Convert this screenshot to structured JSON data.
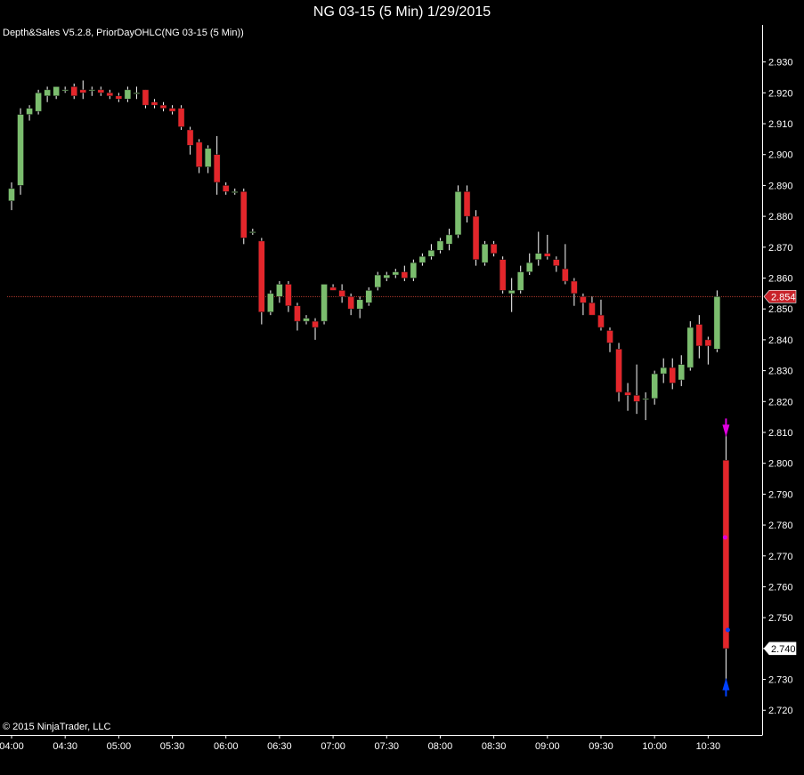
{
  "title": "NG 03-15 (5 Min)  1/29/2015",
  "indicator_label": "Depth&Sales V5.2.8, PriorDayOHLC(NG 03-15 (5 Min))",
  "copyright": "© 2015 NinjaTrader, LLC",
  "colors": {
    "background": "#000000",
    "up": "#7bbd6e",
    "down": "#e3262b",
    "prior_close_line": "#b13a2e",
    "markers_top": "#e000e0",
    "markers_bottom": "#0040ff"
  },
  "chart_data": {
    "type": "candlestick",
    "title": "NG 03-15 (5 Min)  1/29/2015",
    "ylim": [
      2.712,
      2.942
    ],
    "y_ticks": [
      "2.930",
      "2.920",
      "2.910",
      "2.900",
      "2.890",
      "2.880",
      "2.870",
      "2.860",
      "2.850",
      "2.840",
      "2.830",
      "2.820",
      "2.810",
      "2.800",
      "2.790",
      "2.780",
      "2.770",
      "2.760",
      "2.750",
      "2.740",
      "2.730",
      "2.720"
    ],
    "x_ticks": [
      "04:00",
      "04:30",
      "05:00",
      "05:30",
      "06:00",
      "06:30",
      "07:00",
      "07:30",
      "08:00",
      "08:30",
      "09:00",
      "09:30",
      "10:00",
      "10:30"
    ],
    "prior_day_close": {
      "value": 2.854,
      "label": "2.854"
    },
    "last_price": {
      "value": 2.74,
      "label": "2.740"
    },
    "candles": [
      {
        "o": 2.885,
        "h": 2.891,
        "l": 2.882,
        "c": 2.889
      },
      {
        "o": 2.89,
        "h": 2.915,
        "l": 2.887,
        "c": 2.913
      },
      {
        "o": 2.913,
        "h": 2.916,
        "l": 2.911,
        "c": 2.915
      },
      {
        "o": 2.914,
        "h": 2.921,
        "l": 2.913,
        "c": 2.92
      },
      {
        "o": 2.919,
        "h": 2.922,
        "l": 2.917,
        "c": 2.921
      },
      {
        "o": 2.919,
        "h": 2.922,
        "l": 2.918,
        "c": 2.922
      },
      {
        "o": 2.921,
        "h": 2.922,
        "l": 2.92,
        "c": 2.921
      },
      {
        "o": 2.922,
        "h": 2.923,
        "l": 2.918,
        "c": 2.919
      },
      {
        "o": 2.921,
        "h": 2.924,
        "l": 2.918,
        "c": 2.92
      },
      {
        "o": 2.921,
        "h": 2.922,
        "l": 2.919,
        "c": 2.921
      },
      {
        "o": 2.921,
        "h": 2.922,
        "l": 2.919,
        "c": 2.92
      },
      {
        "o": 2.92,
        "h": 2.921,
        "l": 2.918,
        "c": 2.919
      },
      {
        "o": 2.919,
        "h": 2.92,
        "l": 2.917,
        "c": 2.918
      },
      {
        "o": 2.918,
        "h": 2.922,
        "l": 2.917,
        "c": 2.921
      },
      {
        "o": 2.92,
        "h": 2.922,
        "l": 2.918,
        "c": 2.92
      },
      {
        "o": 2.921,
        "h": 2.921,
        "l": 2.915,
        "c": 2.916
      },
      {
        "o": 2.917,
        "h": 2.918,
        "l": 2.915,
        "c": 2.916
      },
      {
        "o": 2.916,
        "h": 2.917,
        "l": 2.914,
        "c": 2.915
      },
      {
        "o": 2.915,
        "h": 2.916,
        "l": 2.913,
        "c": 2.914
      },
      {
        "o": 2.915,
        "h": 2.916,
        "l": 2.908,
        "c": 2.909
      },
      {
        "o": 2.908,
        "h": 2.909,
        "l": 2.9,
        "c": 2.903
      },
      {
        "o": 2.904,
        "h": 2.905,
        "l": 2.894,
        "c": 2.896
      },
      {
        "o": 2.896,
        "h": 2.903,
        "l": 2.894,
        "c": 2.902
      },
      {
        "o": 2.9,
        "h": 2.906,
        "l": 2.887,
        "c": 2.891
      },
      {
        "o": 2.89,
        "h": 2.891,
        "l": 2.887,
        "c": 2.888
      },
      {
        "o": 2.888,
        "h": 2.889,
        "l": 2.887,
        "c": 2.888
      },
      {
        "o": 2.888,
        "h": 2.889,
        "l": 2.871,
        "c": 2.873
      },
      {
        "o": 2.875,
        "h": 2.876,
        "l": 2.874,
        "c": 2.875
      },
      {
        "o": 2.872,
        "h": 2.873,
        "l": 2.845,
        "c": 2.849
      },
      {
        "o": 2.849,
        "h": 2.856,
        "l": 2.848,
        "c": 2.855
      },
      {
        "o": 2.854,
        "h": 2.859,
        "l": 2.852,
        "c": 2.858
      },
      {
        "o": 2.858,
        "h": 2.859,
        "l": 2.849,
        "c": 2.851
      },
      {
        "o": 2.851,
        "h": 2.852,
        "l": 2.843,
        "c": 2.846
      },
      {
        "o": 2.846,
        "h": 2.848,
        "l": 2.845,
        "c": 2.847
      },
      {
        "o": 2.846,
        "h": 2.847,
        "l": 2.84,
        "c": 2.844
      },
      {
        "o": 2.846,
        "h": 2.858,
        "l": 2.845,
        "c": 2.858
      },
      {
        "o": 2.857,
        "h": 2.858,
        "l": 2.856,
        "c": 2.856
      },
      {
        "o": 2.856,
        "h": 2.858,
        "l": 2.852,
        "c": 2.854
      },
      {
        "o": 2.854,
        "h": 2.855,
        "l": 2.848,
        "c": 2.85
      },
      {
        "o": 2.85,
        "h": 2.854,
        "l": 2.847,
        "c": 2.853
      },
      {
        "o": 2.852,
        "h": 2.857,
        "l": 2.851,
        "c": 2.856
      },
      {
        "o": 2.857,
        "h": 2.862,
        "l": 2.856,
        "c": 2.861
      },
      {
        "o": 2.86,
        "h": 2.862,
        "l": 2.859,
        "c": 2.861
      },
      {
        "o": 2.861,
        "h": 2.863,
        "l": 2.86,
        "c": 2.862
      },
      {
        "o": 2.862,
        "h": 2.864,
        "l": 2.859,
        "c": 2.86
      },
      {
        "o": 2.86,
        "h": 2.866,
        "l": 2.859,
        "c": 2.865
      },
      {
        "o": 2.865,
        "h": 2.868,
        "l": 2.864,
        "c": 2.867
      },
      {
        "o": 2.867,
        "h": 2.871,
        "l": 2.866,
        "c": 2.869
      },
      {
        "o": 2.869,
        "h": 2.873,
        "l": 2.868,
        "c": 2.872
      },
      {
        "o": 2.871,
        "h": 2.876,
        "l": 2.869,
        "c": 2.874
      },
      {
        "o": 2.874,
        "h": 2.89,
        "l": 2.873,
        "c": 2.888
      },
      {
        "o": 2.888,
        "h": 2.89,
        "l": 2.878,
        "c": 2.88
      },
      {
        "o": 2.88,
        "h": 2.882,
        "l": 2.864,
        "c": 2.866
      },
      {
        "o": 2.865,
        "h": 2.872,
        "l": 2.864,
        "c": 2.871
      },
      {
        "o": 2.871,
        "h": 2.872,
        "l": 2.867,
        "c": 2.868
      },
      {
        "o": 2.866,
        "h": 2.867,
        "l": 2.855,
        "c": 2.856
      },
      {
        "o": 2.855,
        "h": 2.86,
        "l": 2.849,
        "c": 2.856
      },
      {
        "o": 2.856,
        "h": 2.864,
        "l": 2.855,
        "c": 2.862
      },
      {
        "o": 2.862,
        "h": 2.868,
        "l": 2.861,
        "c": 2.865
      },
      {
        "o": 2.866,
        "h": 2.875,
        "l": 2.864,
        "c": 2.868
      },
      {
        "o": 2.868,
        "h": 2.874,
        "l": 2.866,
        "c": 2.867
      },
      {
        "o": 2.866,
        "h": 2.867,
        "l": 2.862,
        "c": 2.864
      },
      {
        "o": 2.863,
        "h": 2.871,
        "l": 2.858,
        "c": 2.859
      },
      {
        "o": 2.859,
        "h": 2.86,
        "l": 2.851,
        "c": 2.855
      },
      {
        "o": 2.854,
        "h": 2.855,
        "l": 2.848,
        "c": 2.852
      },
      {
        "o": 2.852,
        "h": 2.854,
        "l": 2.848,
        "c": 2.848
      },
      {
        "o": 2.848,
        "h": 2.853,
        "l": 2.843,
        "c": 2.844
      },
      {
        "o": 2.843,
        "h": 2.844,
        "l": 2.836,
        "c": 2.839
      },
      {
        "o": 2.837,
        "h": 2.839,
        "l": 2.82,
        "c": 2.823
      },
      {
        "o": 2.823,
        "h": 2.826,
        "l": 2.817,
        "c": 2.822
      },
      {
        "o": 2.822,
        "h": 2.832,
        "l": 2.816,
        "c": 2.82
      },
      {
        "o": 2.821,
        "h": 2.823,
        "l": 2.814,
        "c": 2.821
      },
      {
        "o": 2.821,
        "h": 2.83,
        "l": 2.819,
        "c": 2.829
      },
      {
        "o": 2.829,
        "h": 2.834,
        "l": 2.826,
        "c": 2.831
      },
      {
        "o": 2.831,
        "h": 2.834,
        "l": 2.824,
        "c": 2.826
      },
      {
        "o": 2.827,
        "h": 2.835,
        "l": 2.825,
        "c": 2.832
      },
      {
        "o": 2.831,
        "h": 2.846,
        "l": 2.83,
        "c": 2.844
      },
      {
        "o": 2.845,
        "h": 2.848,
        "l": 2.834,
        "c": 2.838
      },
      {
        "o": 2.84,
        "h": 2.841,
        "l": 2.832,
        "c": 2.838
      },
      {
        "o": 2.837,
        "h": 2.856,
        "l": 2.836,
        "c": 2.854
      },
      {
        "o": 2.801,
        "h": 2.81,
        "l": 2.729,
        "c": 2.74
      }
    ]
  }
}
